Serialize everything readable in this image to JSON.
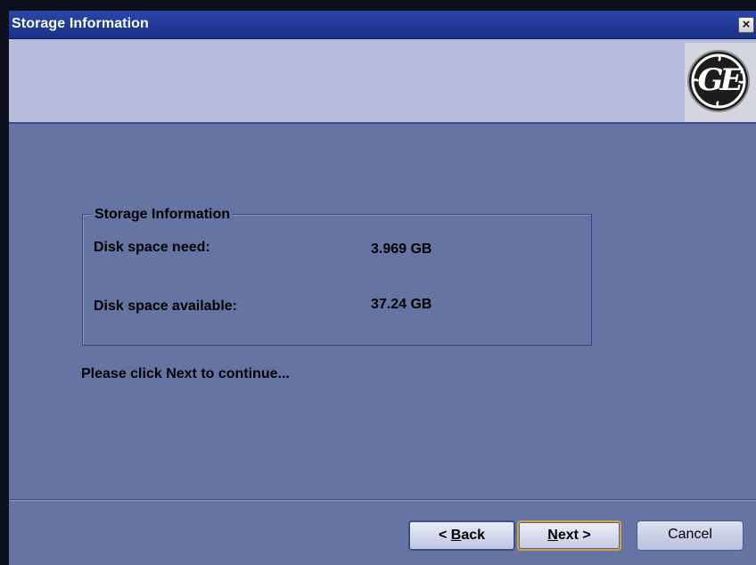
{
  "window": {
    "title": "Storage Information",
    "close_glyph": "×"
  },
  "header": {
    "logo_icon": "ge-logo",
    "logo_text": "GE"
  },
  "group": {
    "legend": "Storage Information",
    "need_label": "Disk space need:",
    "need_value": "3.969 GB",
    "available_label": "Disk space available:",
    "available_value": "37.24 GB"
  },
  "prompt": "Please click Next to continue...",
  "buttons": {
    "back_prefix": "< ",
    "back_mnemonic": "B",
    "back_rest": "ack",
    "next_mnemonic": "N",
    "next_rest": "ext >",
    "cancel": "Cancel"
  },
  "colors": {
    "titlebar": "#213a96",
    "header_band": "#b6bcdc",
    "body": "#6674a4"
  }
}
